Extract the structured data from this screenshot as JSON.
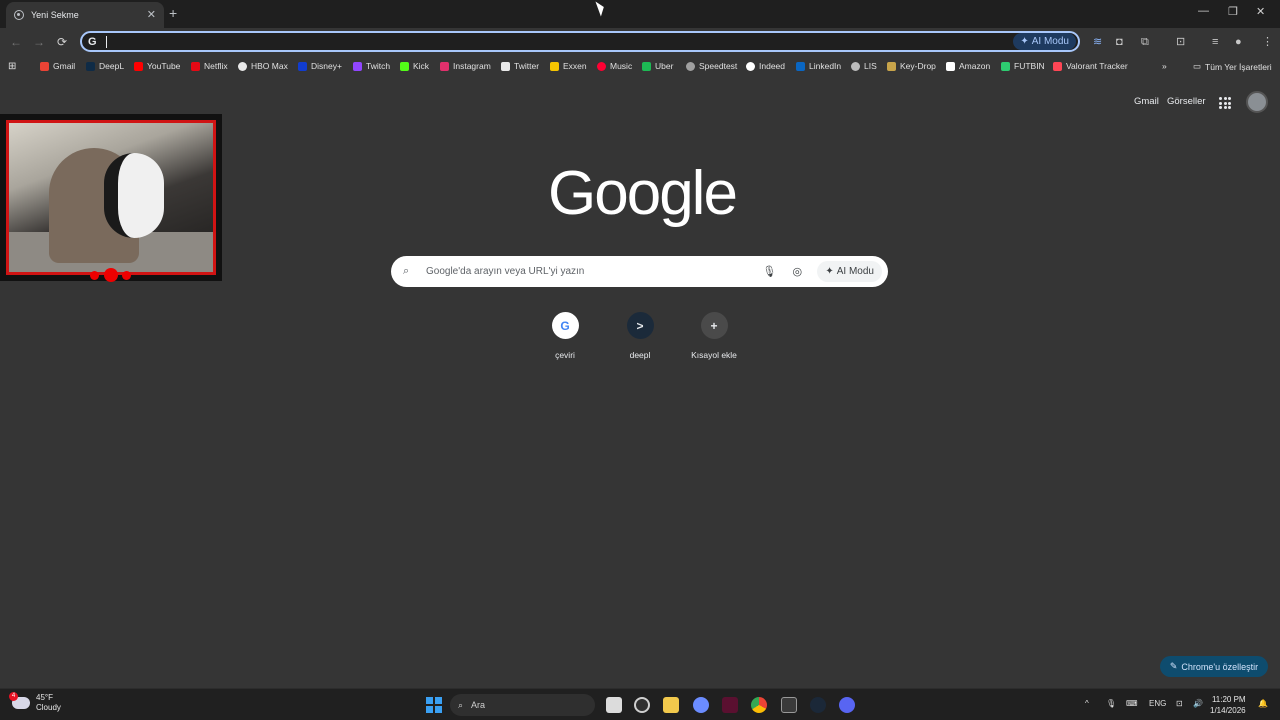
{
  "tab": {
    "title": "Yeni Sekme",
    "close": "✕",
    "new_tab": "+"
  },
  "window_controls": {
    "minimize": "—",
    "restore": "❐",
    "close": "✕"
  },
  "toolbar": {
    "back": "←",
    "forward": "→",
    "reload": "⟳",
    "omnibox_value": "",
    "ai_mode_label": "AI Modu"
  },
  "bookmarks": [
    {
      "label": "Gmail",
      "color": "#ea4335"
    },
    {
      "label": "DeepL",
      "color": "#0f2b46"
    },
    {
      "label": "YouTube",
      "color": "#ff0000"
    },
    {
      "label": "Netflix",
      "color": "#e50914"
    },
    {
      "label": "HBO Max",
      "color": "#e8e8e8"
    },
    {
      "label": "Disney+",
      "color": "#113ccf"
    },
    {
      "label": "Twitch",
      "color": "#9146ff"
    },
    {
      "label": "Kick",
      "color": "#53fc18"
    },
    {
      "label": "Instagram",
      "color": "#e1306c"
    },
    {
      "label": "Twitter",
      "color": "#e8e8e8"
    },
    {
      "label": "Exxen",
      "color": "#f5c400"
    },
    {
      "label": "Music",
      "color": "#ff0033"
    },
    {
      "label": "Uber",
      "color": "#1db954"
    },
    {
      "label": "Speedtest",
      "color": "#a0a0a0"
    },
    {
      "label": "Indeed",
      "color": "#ffffff"
    },
    {
      "label": "LinkedIn",
      "color": "#0a66c2"
    },
    {
      "label": "LIS",
      "color": "#bbbbbb"
    },
    {
      "label": "Key-Drop",
      "color": "#c8a44a"
    },
    {
      "label": "Amazon",
      "color": "#ffffff"
    },
    {
      "label": "FUTBIN",
      "color": "#2ecc71"
    },
    {
      "label": "Valorant Tracker",
      "color": "#ff4655"
    }
  ],
  "bookmarks_more": "»",
  "all_bookmarks": "Tüm Yer İşaretleri",
  "page": {
    "gmail_link": "Gmail",
    "images_link": "Görseller",
    "logo": "Google",
    "search_placeholder": "Google'da arayın veya URL'yi yazın",
    "ai_mode_label": "AI Modu",
    "shortcuts": [
      {
        "label": "çeviri",
        "glyph": "G"
      },
      {
        "label": "deepl",
        "glyph": ">"
      },
      {
        "label": "Kısayol ekle",
        "glyph": "+"
      }
    ],
    "customize_label": "Chrome'u özelleştir"
  },
  "taskbar": {
    "weather_temp": "45°F",
    "weather_desc": "Cloudy",
    "weather_badge": "4",
    "search_label": "Ara",
    "language": "ENG",
    "time": "11:20 PM",
    "date": "1/14/2026"
  },
  "colors": {
    "accent": "#a8c7fa",
    "page_bg": "#353535",
    "webcam_border": "#d01414"
  }
}
